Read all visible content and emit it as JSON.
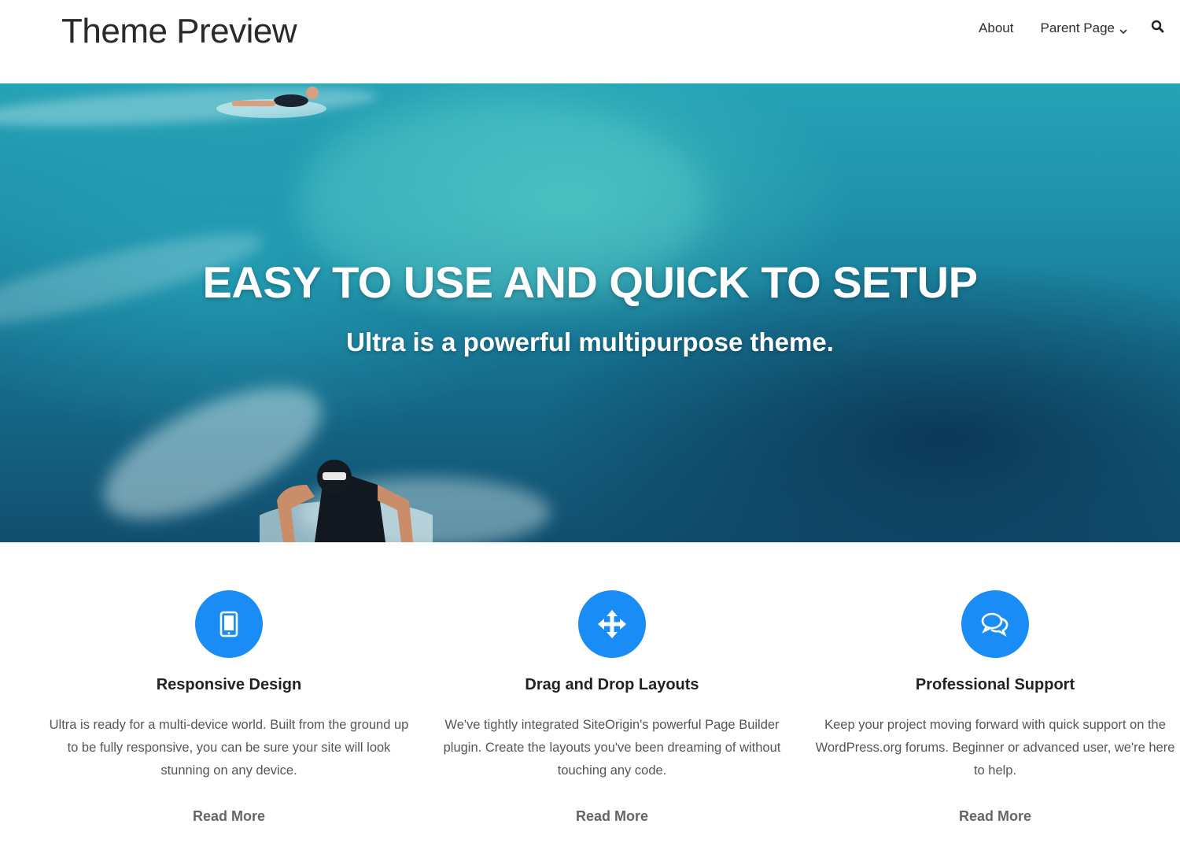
{
  "header": {
    "site_title": "Theme Preview",
    "nav": [
      {
        "label": "About"
      },
      {
        "label": "Parent Page"
      }
    ],
    "search_icon": "search-icon"
  },
  "hero": {
    "title": "EASY TO USE AND QUICK TO SETUP",
    "subtitle": "Ultra is a powerful multipurpose theme."
  },
  "features": [
    {
      "icon": "tablet-icon",
      "title": "Responsive Design",
      "text": "Ultra is ready for a multi-device world. Built from the ground up to be fully responsive, you can be sure your site will look stunning on any device.",
      "link": "Read More"
    },
    {
      "icon": "move-arrows-icon",
      "title": "Drag and Drop Layouts",
      "text": "We've tightly integrated SiteOrigin's powerful Page Builder plugin. Create the layouts you've been dreaming of without touching any code.",
      "link": "Read More"
    },
    {
      "icon": "chat-bubbles-icon",
      "title": "Professional Support",
      "text": "Keep your project moving forward with quick support on the WordPress.org forums. Beginner or advanced user, we're here to help.",
      "link": "Read More"
    }
  ],
  "colors": {
    "accent": "#1a8cf5",
    "hero_water": "#1e8fa9"
  }
}
